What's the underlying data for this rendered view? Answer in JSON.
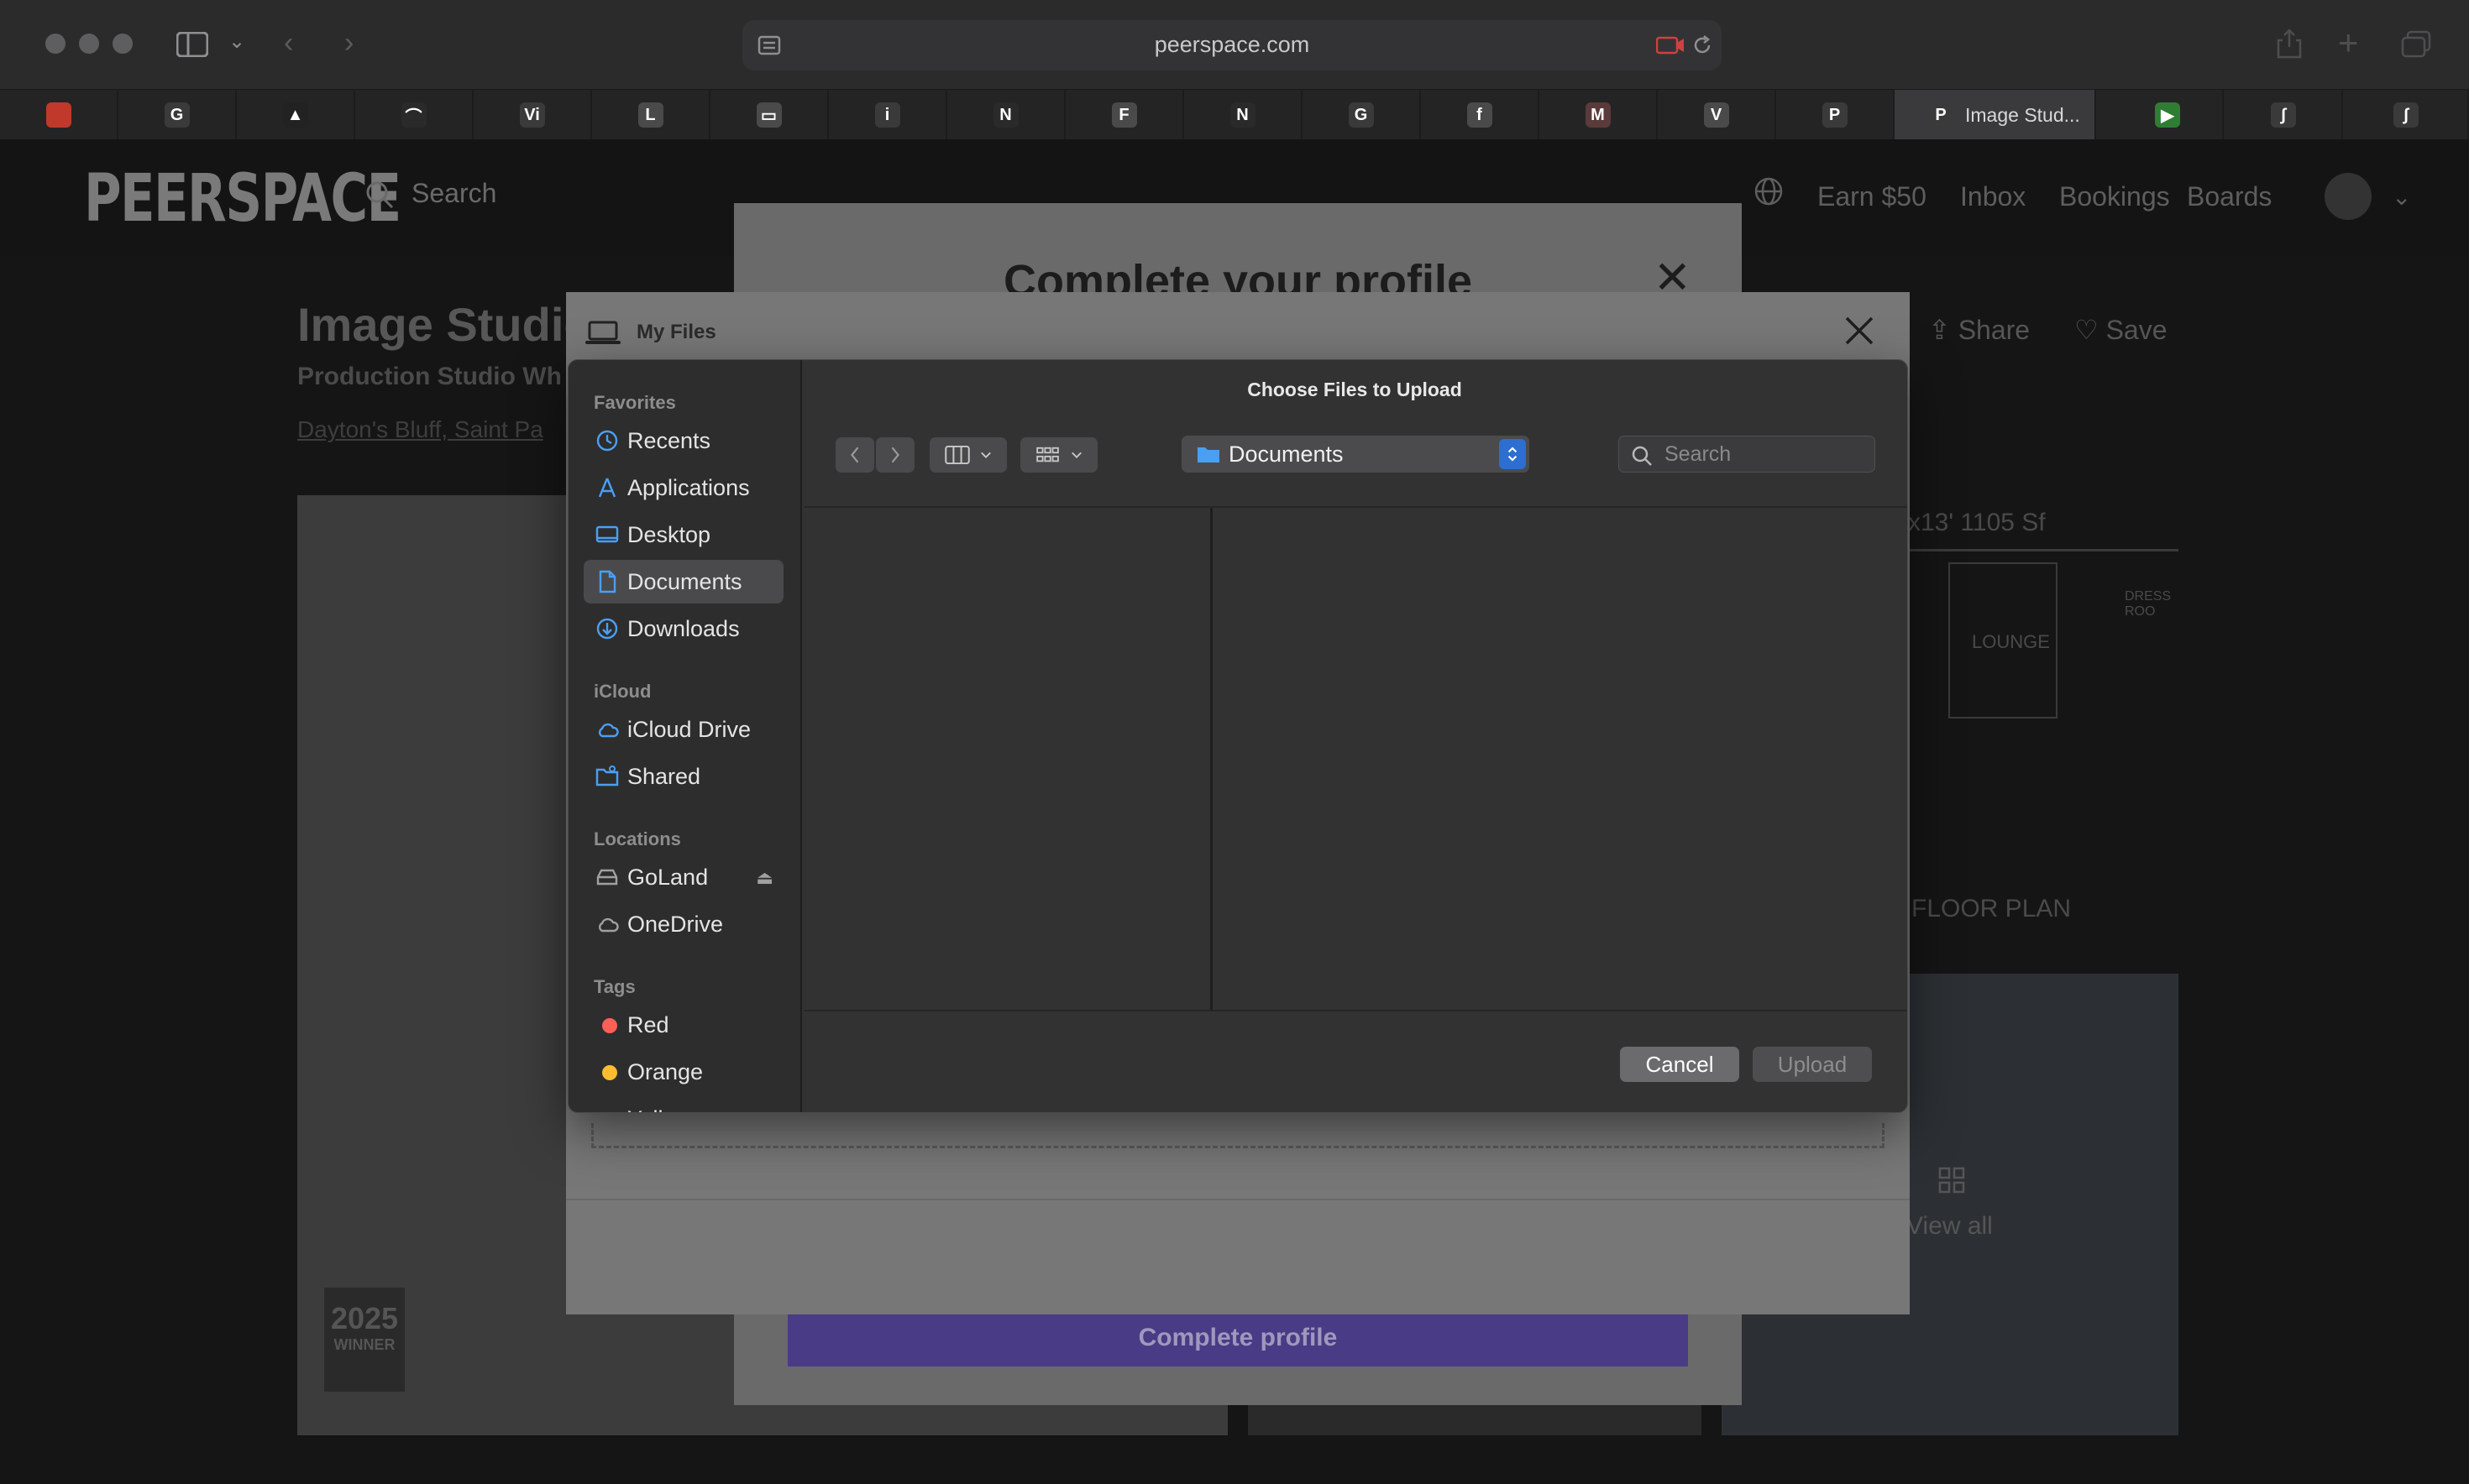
{
  "browser": {
    "address": "peerspace.com",
    "active_tab_title": "Image Stud...",
    "tabs": [
      {
        "icon": "red-square-favicon",
        "glyph": "",
        "color": "#c0392b"
      },
      {
        "icon": "google-favicon",
        "glyph": "G",
        "color": "#3a3a3a"
      },
      {
        "icon": "triangle-app-favicon",
        "glyph": "▲",
        "color": "#222"
      },
      {
        "icon": "green-arc-favicon",
        "glyph": "⌒",
        "color": "#2a2a2a"
      },
      {
        "icon": "vi-favicon",
        "glyph": "Vi",
        "color": "#3a3a3a"
      },
      {
        "icon": "l-favicon",
        "glyph": "L",
        "color": "#4a4a4a"
      },
      {
        "icon": "folder-favicon",
        "glyph": "▭",
        "color": "#4a4a4a"
      },
      {
        "icon": "info-favicon",
        "glyph": "i",
        "color": "#3a3a3a"
      },
      {
        "icon": "n-gold-favicon",
        "glyph": "N",
        "color": "#2a2a2a"
      },
      {
        "icon": "f-favicon",
        "glyph": "F",
        "color": "#4a4a4a"
      },
      {
        "icon": "n-gold-favicon",
        "glyph": "N",
        "color": "#2a2a2a"
      },
      {
        "icon": "google-favicon",
        "glyph": "G",
        "color": "#3a3a3a"
      },
      {
        "icon": "f-italic-favicon",
        "glyph": "f",
        "color": "#4a4a4a"
      },
      {
        "icon": "m-favicon",
        "glyph": "M",
        "color": "#5a3a3a"
      },
      {
        "icon": "v-favicon",
        "glyph": "V",
        "color": "#4a4a4a"
      },
      {
        "icon": "p-favicon",
        "glyph": "P",
        "color": "#3a3a3a"
      }
    ]
  },
  "site": {
    "logo": "PEERSPACE",
    "search_label": "Search",
    "nav": {
      "earn": "Earn $50",
      "inbox": "Inbox",
      "bookings": "Bookings",
      "boards": "Boards"
    },
    "title": "Image Studio",
    "subtitle": "Production Studio Wh",
    "location": "Dayton's Bluff, Saint Pa",
    "share": "Share",
    "save": "Save",
    "plan_dims": "x13' 1105 Sf",
    "plan_lounge": "LOUNGE",
    "plan_dress": "DRESS\nROO",
    "plan_floor": "FLOOR PLAN",
    "view_all": "View all",
    "badge_year": "2025",
    "badge_word": "WINNER"
  },
  "profile_modal": {
    "title": "Complete your profile",
    "button": "Complete profile"
  },
  "my_files": {
    "title": "My Files"
  },
  "dialog": {
    "title": "Choose Files to Upload",
    "location": "Documents",
    "search_placeholder": "Search",
    "cancel": "Cancel",
    "upload": "Upload",
    "sections": {
      "favorites": "Favorites",
      "icloud": "iCloud",
      "locations": "Locations",
      "tags": "Tags"
    },
    "favorites": [
      {
        "label": "Recents",
        "icon": "clock-icon"
      },
      {
        "label": "Applications",
        "icon": "applications-icon"
      },
      {
        "label": "Desktop",
        "icon": "desktop-icon"
      },
      {
        "label": "Documents",
        "icon": "document-icon",
        "selected": true
      },
      {
        "label": "Downloads",
        "icon": "download-icon"
      }
    ],
    "icloud": [
      {
        "label": "iCloud Drive",
        "icon": "cloud-icon"
      },
      {
        "label": "Shared",
        "icon": "shared-folder-icon"
      }
    ],
    "locations": [
      {
        "label": "GoLand",
        "icon": "drive-icon"
      },
      {
        "label": "OneDrive",
        "icon": "cloud-icon"
      }
    ],
    "tags": [
      {
        "label": "Red",
        "color": "#ff5f57"
      },
      {
        "label": "Orange",
        "color": "#febc2e"
      },
      {
        "label": "Yellow",
        "color": "#f5d300"
      }
    ]
  },
  "colors": {
    "accent": "#2d6ed3",
    "sidebar_icon": "#4a9ff5",
    "profile_button": "#4a3b86"
  }
}
